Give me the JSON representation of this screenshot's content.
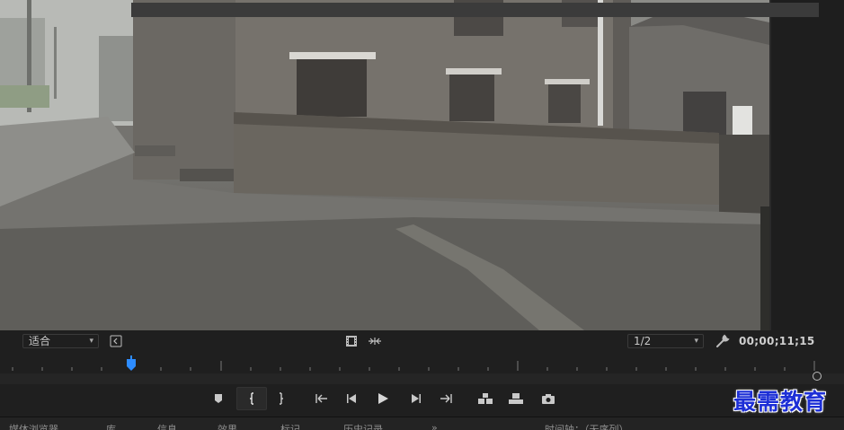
{
  "monitor": {
    "fit_label": "适合",
    "resolution_label": "1/2",
    "timecode": "00;00;11;15"
  },
  "icons": {
    "safe_margins": "safe-margins-icon",
    "insert_frame": "film-frame-icon",
    "toggle_proxies": "proxy-toggle-icon",
    "settings": "wrench-icon",
    "add_marker": "marker-icon",
    "mark_in": "mark-in-icon",
    "mark_out": "mark-out-icon",
    "go_to_in": "go-to-in-icon",
    "step_back": "step-back-icon",
    "play": "play-icon",
    "step_forward": "step-forward-icon",
    "go_to_out": "go-to-out-icon",
    "insert": "insert-icon",
    "overwrite": "overwrite-icon",
    "export_frame": "camera-icon"
  },
  "playhead_position": 0.0,
  "panel_tabs": [
    "媒体浏览器",
    "库",
    "信息",
    "效果",
    "标记",
    "历史记录"
  ],
  "panel_more": "»",
  "right_panel_title": "时间轴：（无序列）",
  "watermark": "最需教育",
  "colors": {
    "playhead": "#2d8cff",
    "watermark": "#1d2fd6"
  }
}
